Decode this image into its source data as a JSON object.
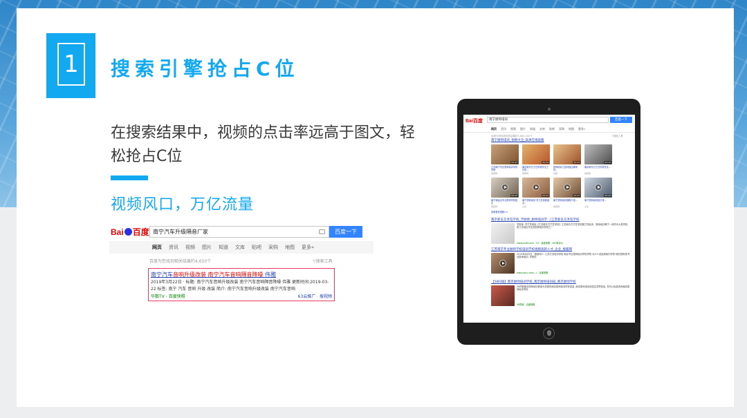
{
  "section": {
    "number": "1",
    "title": "搜索引擎抢占C位"
  },
  "description": "在搜索结果中，视频的点击率远高于图文，轻松抢占C位",
  "subtitle": "视频风口，万亿流量",
  "colors": {
    "accent": "#13a9f0",
    "baidu_red": "#e10602",
    "baidu_blue": "#3385ff",
    "link_blue": "#2440b3",
    "highlight_border": "#e83a5e"
  },
  "baidu_small": {
    "logo_left": "Bai",
    "logo_right": "百度",
    "query": "南宁汽车升级隔音厂家",
    "search_button": "百度一下",
    "tabs": [
      "网页",
      "资讯",
      "视频",
      "图片",
      "知道",
      "文库",
      "贴吧",
      "采购",
      "地图",
      "更多»"
    ],
    "result_stats": "百度为您找到相关结果约4,650个",
    "tools": "▽搜索工具",
    "result": {
      "title_pre": "南宁汽车",
      "title_hl1": "音响升级改装 南宁汽车音响",
      "title_mid": "隔音降噪 ",
      "title_end": "伟雅",
      "line1": "2019年3月22日 · 标题: 南宁汽车音响升级改装 南宁汽车音响隔音降噪 伟雅 更新时间:2019-03-",
      "line2": "22 标签: 南宁 汽车 音响 升级 改装 简介: 南宁汽车音响升级改装 南宁汽车音响",
      "source": "华数TV - 百度快照",
      "right_label": "63云推广 · 搜视频"
    }
  },
  "baidu_tablet": {
    "logo": "Bai百度",
    "query": "南宁厨师培训",
    "search_button": "百度一下",
    "tabs": [
      "网页",
      "资讯",
      "视频",
      "图片",
      "知道",
      "文库",
      "贴吧",
      "采购",
      "地图",
      "更多»"
    ],
    "result_stats": "百度为您找到相关结果约3,800,000个",
    "tools": "▽搜索工具",
    "video_group_title": "南宁厨师培训_视频大全_高清在线观看",
    "row1": [
      {
        "caption": "江苏南宁专业厨师培训学校学院",
        "source": "搜狐网",
        "duration": "02:43"
      },
      {
        "caption": "南京新东方烹饪学校专业烹饪学...",
        "source": "搜狐网",
        "duration": "00:30"
      },
      {
        "caption": "厨师培训之如何做出美味的...",
        "source": "优酷",
        "duration": "02:43"
      },
      {
        "caption": "南京新东方烹饪学校专业...",
        "source": "搜狐网",
        "duration": "02:10"
      }
    ],
    "row2": [
      {
        "caption": "南宁新起点专业厨师学校招生",
        "source": "搜狐网",
        "duration": "02:43"
      },
      {
        "caption": "南宁厨师培训 学烹饪到新起点...",
        "source": "土豆",
        "duration": "02:43"
      },
      {
        "caption": "南宁厨师培训课程介绍...",
        "source": "搜狐网",
        "duration": "02:43"
      },
      {
        "caption": "南宁厨师培训班日常...",
        "source": "土豆",
        "duration": "02:43"
      }
    ],
    "more_videos": "查看更多视频>>",
    "results": [
      {
        "title": "南京新东方烹饪学校_学厨师_厨师培训学...(江苏新东方烹饪学校",
        "snippet": "学厨师, 学烹饪就到【江苏新东方烹饪学校】江苏新东方烹饪学校集烹饪培训、厨师培训等于一体的中大型学校, 是江苏地区专业的厨师培训学校之一",
        "source": "www.jsxdf.com/ - V3 - 百度快照 - 263条评价"
      },
      {
        "title": "江苏南京专业厨师学校培训学校视频高新人才_企业_搜狐网",
        "snippet": "2019年6月5日 · 视频简介: 江苏烹饪培训学校 南京专业厨师培训学校学院 为什么说选择我们学校?我们拥有的专业厨师培训, 学院的",
        "source": "www.sohu.com/.../ - 百度快照"
      },
      {
        "title": "【58同城】南京厨师培训学校_南京厨师培训班_南京厨师学校",
        "snippet": "58同城南京厨师培训频道为您提供南京厨师培训学校信息, 南京厨师培训班招生简章信息, 您可以免费查询南京厨师培训学校",
        "source": "58同城 - 百度快照"
      }
    ]
  }
}
